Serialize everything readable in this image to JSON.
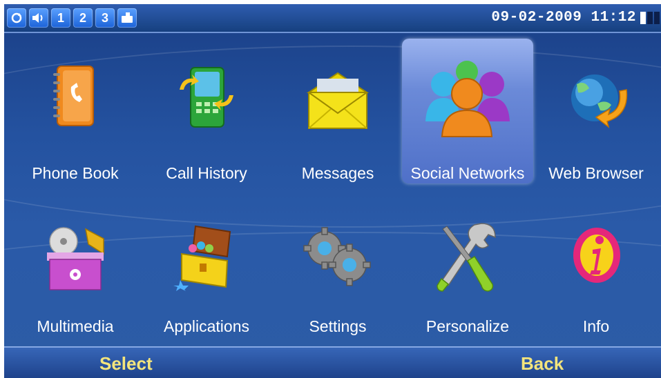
{
  "status_bar": {
    "icons": [
      "sync-icon",
      "speaker-icon",
      "1",
      "2",
      "3",
      "keyboard-icon"
    ],
    "datetime": "09-02-2009 11:12",
    "battery": "battery-icon"
  },
  "menu": {
    "row1": [
      {
        "label": "Phone Book",
        "icon": "phone-book-icon"
      },
      {
        "label": "Call History",
        "icon": "call-history-icon"
      },
      {
        "label": "Messages",
        "icon": "envelope-icon"
      },
      {
        "label": "Social Networks",
        "icon": "people-icon",
        "selected": true
      },
      {
        "label": "Web Browser",
        "icon": "globe-icon"
      }
    ],
    "row2": [
      {
        "label": "Multimedia",
        "icon": "multimedia-icon"
      },
      {
        "label": "Applications",
        "icon": "treasure-chest-icon"
      },
      {
        "label": "Settings",
        "icon": "gears-icon"
      },
      {
        "label": "Personalize",
        "icon": "tools-icon"
      },
      {
        "label": "Info",
        "icon": "info-icon"
      }
    ]
  },
  "softkeys": {
    "left": "Select",
    "right": "Back"
  },
  "colors": {
    "background": "#2452a0",
    "softkey_text": "#f3e47c",
    "selected_tile": "#6b8ad8"
  }
}
